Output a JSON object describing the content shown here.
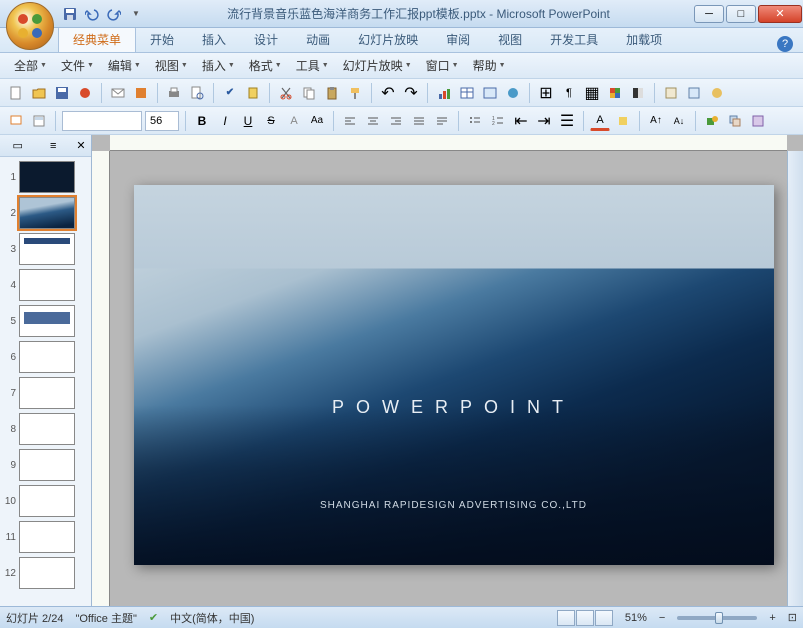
{
  "window": {
    "title": "流行背景音乐蓝色海洋商务工作汇报ppt模板.pptx - Microsoft PowerPoint"
  },
  "ribbon_tabs": [
    "经典菜单",
    "开始",
    "插入",
    "设计",
    "动画",
    "幻灯片放映",
    "审阅",
    "视图",
    "开发工具",
    "加载项"
  ],
  "active_tab": 0,
  "menus": [
    "全部",
    "文件",
    "编辑",
    "视图",
    "插入",
    "格式",
    "工具",
    "幻灯片放映",
    "窗口",
    "帮助"
  ],
  "font_size": "56",
  "slide": {
    "title": "POWERPOINT",
    "subtitle": "SHANGHAI RAPIDESIGN ADVERTISING CO.,LTD"
  },
  "thumbnails": {
    "count": 12,
    "selected": 2
  },
  "status": {
    "slide_counter": "幻灯片 2/24",
    "theme": "\"Office 主题\"",
    "language": "中文(简体，中国)",
    "zoom": "51%"
  }
}
